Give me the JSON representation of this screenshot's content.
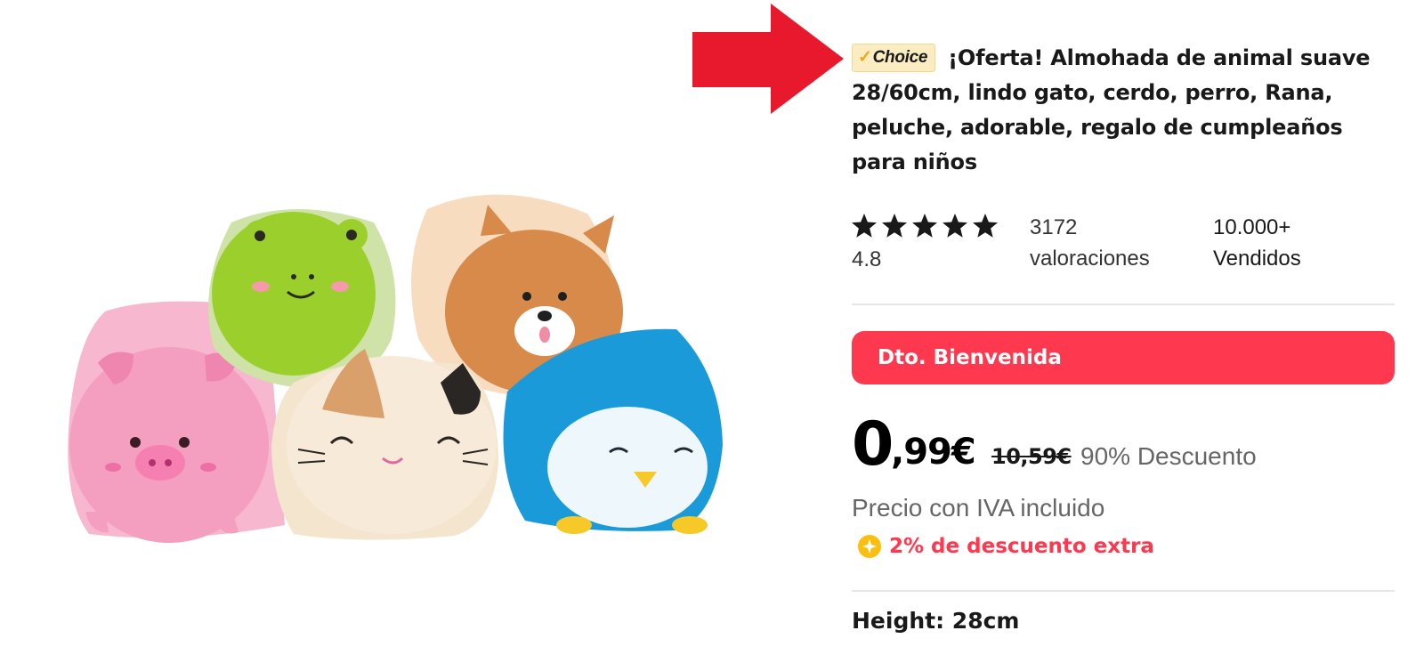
{
  "product": {
    "badge": {
      "check": "✓",
      "label": "Choice"
    },
    "title": "¡Oferta! Almohada de animal suave 28/60cm, lindo gato, cerdo, perro, Rana, peluche, adorable, regalo de cumpleaños para niños",
    "image_alt": "Peluches de cerdo, rana, gato, perro y pingüino",
    "rating_stars": 5,
    "rating": "4.8",
    "reviews": "3172 valoraciones",
    "sold": "10.000+ Vendidos"
  },
  "promo": {
    "welcome_label": "Dto. Bienvenida"
  },
  "price": {
    "integer": "0",
    "decimal": ",99€",
    "original": "10,59€",
    "discount": "90% Descuento",
    "tax_note": "Precio con IVA incluido",
    "extra_discount": "2% de descuento extra"
  },
  "specs": {
    "height": "Height: 28cm"
  },
  "colors": {
    "accent_red": "#fd384f",
    "arrow_red": "#e8192c",
    "badge_bg": "#fbedc1",
    "coin_yellow": "#fbbf0f"
  },
  "icons": {
    "star": "star-icon",
    "coin": "coin-icon",
    "arrow": "red-arrow-annotation"
  }
}
